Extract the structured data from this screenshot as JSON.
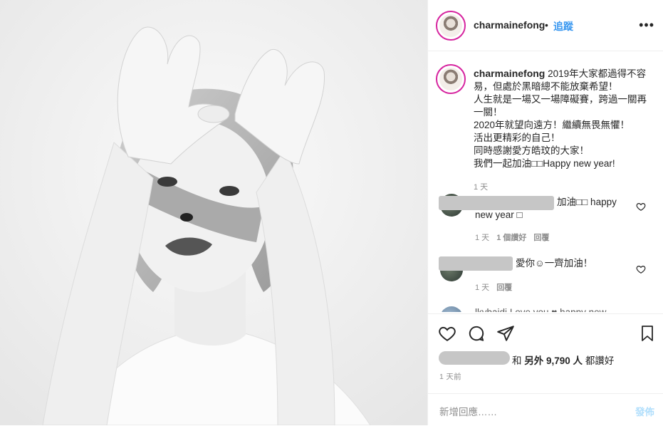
{
  "post": {
    "username": "charmainefong",
    "dot": "•",
    "follow_label": "追蹤",
    "more_icon": "more-horizontal-icon",
    "caption": {
      "username": "charmainefong",
      "text": "2019年大家都過得不容易，但處於黑暗總不能放棄希望！\n人生就是一場又一場障礙賽，跨過一關再一關！\n2020年就望向遠方！繼續無畏無懼！\n活出更精彩的自己！\n同時感謝愛方皓玟的大家！\n我們一起加油□□Happy new year!",
      "time": "1 天"
    },
    "comments": [
      {
        "text_line1": "加油□□ happy",
        "text_line2": "new year □",
        "time": "1 天",
        "likes": "1 個讚好",
        "reply": "回覆"
      },
      {
        "text": "愛你☺一齊加油！",
        "time": "1 天",
        "reply": "回覆"
      },
      {
        "partial_text": "lkybaidi I ove you ♥ happy new"
      }
    ],
    "likes": {
      "middle": "和 ",
      "others_label": "另外 9,790 人",
      "suffix": " 都讚好"
    },
    "time_ago": "1 天前",
    "add_comment_placeholder": "新增回應……",
    "post_button": "發佈",
    "icons": {
      "like": "heart-icon",
      "comment": "comment-icon",
      "share": "share-icon",
      "save": "bookmark-icon"
    },
    "colors": {
      "accent": "#3897f0",
      "post_disabled": "#b2dffc",
      "muted": "#8e8e8e"
    }
  }
}
